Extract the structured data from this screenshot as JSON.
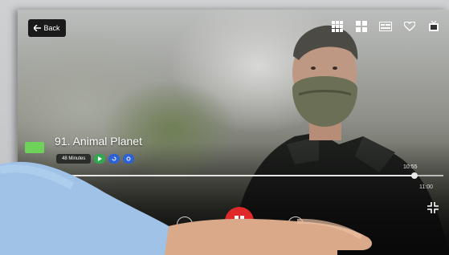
{
  "top_bar": {
    "back_label": "Back",
    "icons": [
      "grid-icon",
      "tiles-icon",
      "guide-icon",
      "heart-icon",
      "tv-icon"
    ]
  },
  "player": {
    "channel_title": "91. Animal Planet",
    "duration_chip": "48 Minutes",
    "time_elapsed": "10:55",
    "time_total": "11:00",
    "progress": 0.93,
    "colors": {
      "play_button": "#e02a2a",
      "chip_green": "#2fa84f",
      "chip_blue": "#2d62d6",
      "channel_logo": "#6dd15a"
    }
  }
}
